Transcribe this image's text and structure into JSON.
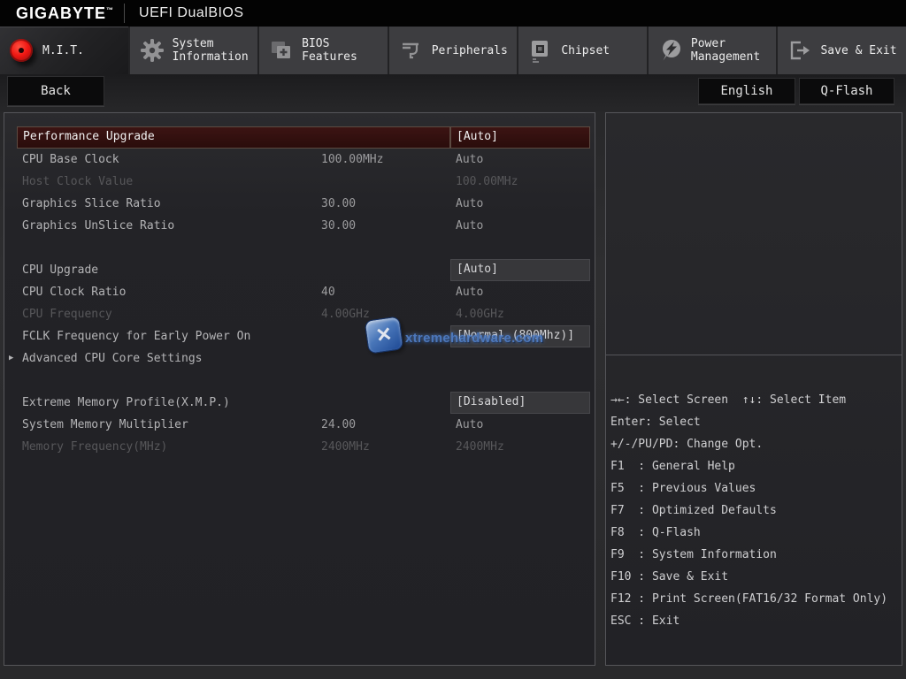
{
  "header": {
    "brand": "GIGABYTE",
    "brand_tm": "™",
    "title": "UEFI DualBIOS"
  },
  "tabs": [
    {
      "label": "M.I.T.",
      "active": true
    },
    {
      "label": "System Information",
      "active": false
    },
    {
      "label": "BIOS Features",
      "active": false
    },
    {
      "label": "Peripherals",
      "active": false
    },
    {
      "label": "Chipset",
      "active": false
    },
    {
      "label": "Power Management",
      "active": false
    },
    {
      "label": "Save & Exit",
      "active": false
    }
  ],
  "buttons": {
    "back": "Back",
    "language": "English",
    "qflash": "Q-Flash"
  },
  "settings": {
    "rows": [
      {
        "label": "Performance Upgrade",
        "value": "[Auto]",
        "type": "highlighted"
      },
      {
        "label": "CPU Base Clock",
        "current": "100.00MHz",
        "value": "Auto",
        "type": "normal"
      },
      {
        "label": "Host Clock Value",
        "current": "",
        "value": "100.00MHz",
        "type": "disabled"
      },
      {
        "label": "Graphics Slice Ratio",
        "current": "30.00",
        "value": "Auto",
        "type": "normal"
      },
      {
        "label": "Graphics UnSlice Ratio",
        "current": "30.00",
        "value": "Auto",
        "type": "normal"
      },
      {
        "label": "CPU Upgrade",
        "value": "[Auto]",
        "type": "option"
      },
      {
        "label": "CPU Clock Ratio",
        "current": "40",
        "value": "Auto",
        "type": "normal"
      },
      {
        "label": "CPU Frequency",
        "current": "4.00GHz",
        "value": "4.00GHz",
        "type": "disabled"
      },
      {
        "label": "FCLK Frequency for Early Power On",
        "value": "[Normal (800Mhz)]",
        "type": "option"
      },
      {
        "label": "Advanced CPU Core Settings",
        "arrow": "▶",
        "type": "submenu"
      },
      {
        "label": "Extreme Memory Profile(X.M.P.)",
        "value": "[Disabled]",
        "type": "option"
      },
      {
        "label": "System Memory Multiplier",
        "current": "24.00",
        "value": "Auto",
        "type": "normal"
      },
      {
        "label": "Memory Frequency(MHz)",
        "current": "2400MHz",
        "value": "2400MHz",
        "type": "disabled"
      }
    ]
  },
  "help": {
    "lines": [
      "→←: Select Screen  ↑↓: Select Item",
      "Enter: Select",
      "+/-/PU/PD: Change Opt.",
      "F1  : General Help",
      "F5  : Previous Values",
      "F7  : Optimized Defaults",
      "F8  : Q-Flash",
      "F9  : System Information",
      "F10 : Save & Exit",
      "F12 : Print Screen(FAT16/32 Format Only)",
      "ESC : Exit"
    ]
  },
  "watermark": {
    "text": "xtremehardware.com",
    "glyph": "✕"
  },
  "colors": {
    "accent_red": "#ef1612",
    "highlight_row_bg": "#33100f",
    "option_cell_bg": "#37373a",
    "panel_border": "#56565a",
    "watermark_blue": "#4f7cc2"
  }
}
